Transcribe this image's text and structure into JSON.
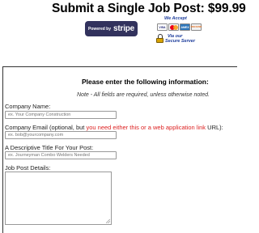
{
  "header": {
    "title": "Submit a Single Job Post: $99.99"
  },
  "payment": {
    "stripe_prefix": "Powered by",
    "stripe_brand": "stripe",
    "we_accept": "We Accept",
    "cards": [
      "VISA",
      "MasterCard",
      "AMEX",
      "DISCOVER"
    ],
    "secure_line1": "Via our",
    "secure_line2": "Secure Server"
  },
  "form": {
    "heading": "Please enter the following information:",
    "note": "Note - All fields are required, unless otherwise noted.",
    "company_name": {
      "label": "Company Name:",
      "placeholder": "ex. Your Company Construction"
    },
    "company_email": {
      "label_start": "Company Email (optional, but ",
      "label_red": "you need either this or a web application link",
      "label_end": " URL):",
      "placeholder": "ex. bob@yourcompany.com"
    },
    "post_title": {
      "label": "A Descriptive Title For Your Post:",
      "placeholder": "ex. Journeyman Combo Welders Needed"
    },
    "details": {
      "label": "Job Post Details:"
    }
  }
}
